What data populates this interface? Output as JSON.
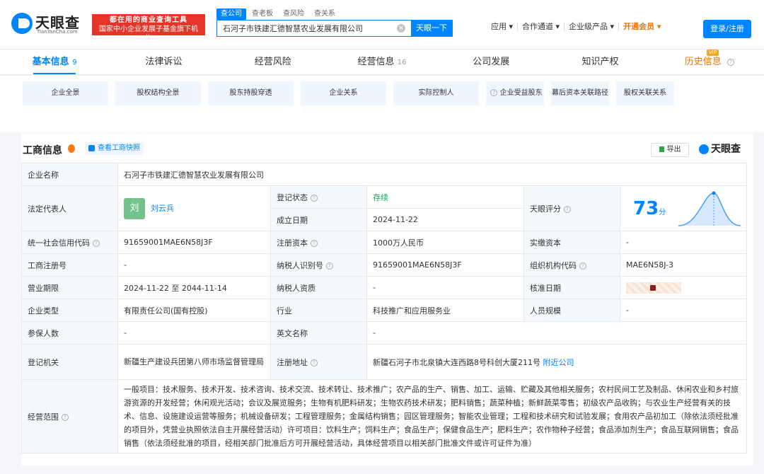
{
  "header": {
    "logo_text": "天眼查",
    "logo_sub": "TianYanCha.com",
    "slogan_line1": "都在用的商业查询工具",
    "slogan_line2": "国家中小企业发展子基金旗下机构",
    "search_tabs": [
      "查公司",
      "查老板",
      "查风险",
      "查关系"
    ],
    "search_value": "石河子市铁建汇德智慧农业发展有限公司",
    "search_clear": "×",
    "search_button": "天眼一下",
    "nav": [
      "应用 ▾",
      "合作通道 ▾",
      "企业级产品 ▾",
      "开通会员 ▾"
    ],
    "login": "登录/注册"
  },
  "tabs": [
    {
      "label": "基本信息",
      "count": "9"
    },
    {
      "label": "法律诉讼",
      "count": ""
    },
    {
      "label": "经营风险",
      "count": ""
    },
    {
      "label": "经营信息",
      "count": "16"
    },
    {
      "label": "公司发展",
      "count": ""
    },
    {
      "label": "知识产权",
      "count": ""
    },
    {
      "label": "历史信息",
      "count": ""
    }
  ],
  "vip_tag": "VIP",
  "subnav": [
    "企业全景",
    "股权结构全景",
    "股东持股穿透",
    "企业关系",
    "实际控制人",
    "企业受益股东",
    "幕后资本关联路径",
    "股权关联关系"
  ],
  "section": {
    "title": "工商信息",
    "snapshot": "查看工商快照",
    "export": "导出",
    "brand": "天眼查"
  },
  "info": {
    "company_name_label": "企业名称",
    "company_name": "石河子市铁建汇德智慧农业发展有限公司",
    "legal_rep_label": "法定代表人",
    "legal_rep_avatar": "刘",
    "legal_rep": "刘云兵",
    "reg_status_label": "登记状态",
    "reg_status": "存续",
    "found_date_label": "成立日期",
    "found_date": "2024-11-22",
    "score_label": "天眼评分",
    "score": "73",
    "score_unit": "分",
    "credit_code_label": "统一社会信用代码",
    "credit_code": "91659001MAE6N58J3F",
    "reg_capital_label": "注册资本",
    "reg_capital": "1000万人民币",
    "paid_capital_label": "实缴资本",
    "paid_capital": "-",
    "reg_no_label": "工商注册号",
    "reg_no": "-",
    "taxpayer_id_label": "纳税人识别号",
    "taxpayer_id": "91659001MAE6N58J3F",
    "org_code_label": "组织机构代码",
    "org_code": "MAE6N58J-3",
    "term_label": "营业期限",
    "term": "2024-11-22 至 2044-11-14",
    "taxpayer_qual_label": "纳税人资质",
    "taxpayer_qual": "-",
    "approve_date_label": "核准日期",
    "type_label": "企业类型",
    "type": "有限责任公司(国有控股)",
    "industry_label": "行业",
    "industry": "科技推广和应用服务业",
    "staff_label": "人员规模",
    "staff": "-",
    "insured_label": "参保人数",
    "insured": "-",
    "en_name_label": "英文名称",
    "en_name": "-",
    "reg_authority_label": "登记机关",
    "reg_authority": "新疆生产建设兵团第八师市场监督管理局",
    "address_label": "注册地址",
    "address": "新疆石河子市北泉镇大连西路8号科创大厦211号",
    "nearby": "附近公司",
    "scope_label": "经营范围",
    "scope": "一般项目：技术服务、技术开发、技术咨询、技术交流、技术转让、技术推广；农产品的生产、销售、加工、运输、贮藏及其他相关服务；农村民间工艺及制品、休闲农业和乡村旅游资源的开发经营；休闲观光活动；会议及展览服务；生物有机肥料研发；生物农药技术研发；肥料销售；蔬菜种植；新鲜蔬菜零售；初级农产品收购；与农业生产经营有关的技术、信息、设施建设运营等服务；机械设备研发；工程管理服务；金属结构销售；园区管理服务；智能农业管理；工程和技术研究和试验发展；食用农产品初加工（除依法须经批准的项目外，凭营业执照依法自主开展经营活动）许可项目：饮料生产；饲料生产；食品生产；保健食品生产；肥料生产；农作物种子经营；食品添加剂生产；食品互联网销售；食品销售（依法须经批准的项目，经相关部门批准后方可开展经营活动，具体经营项目以相关部门批准文件或许可证件为准）"
  },
  "colors": {
    "accent": "#0084ff",
    "status": "#18a55a",
    "slogan": "#e5352b"
  }
}
